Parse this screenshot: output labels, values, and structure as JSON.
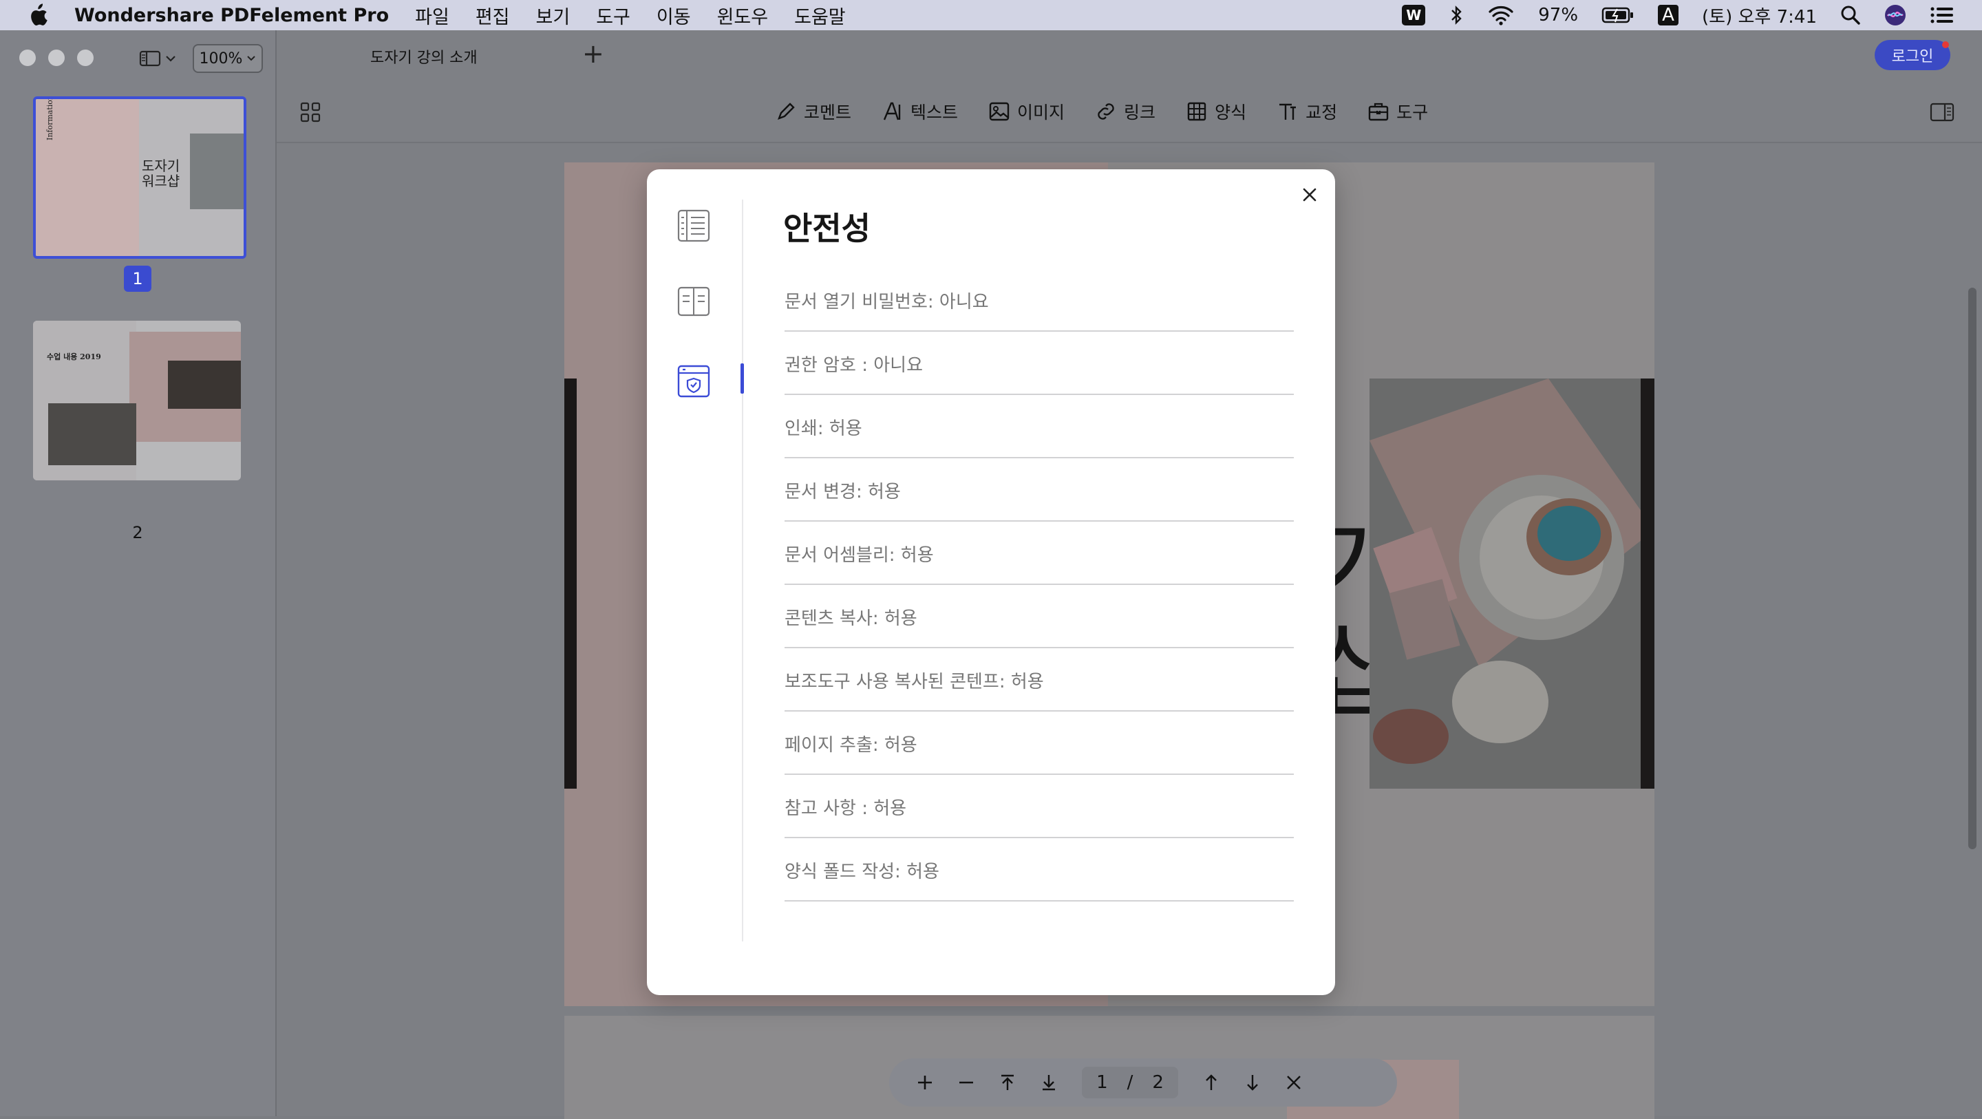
{
  "menubar": {
    "app_name": "Wondershare PDFelement Pro",
    "menus": [
      "파일",
      "편집",
      "보기",
      "도구",
      "이동",
      "윈도우",
      "도움말"
    ],
    "battery": "97%",
    "input_source": "A",
    "clock": "(토) 오후 7:41"
  },
  "sidebar": {
    "zoom": "100%",
    "pages": [
      "1",
      "2"
    ]
  },
  "tabbar": {
    "tab_title": "도자기 강의 소개",
    "add_tab": "+",
    "login": "로그인"
  },
  "toolbar": {
    "tools": [
      {
        "label": "코멘트",
        "icon": "pen-icon"
      },
      {
        "label": "텍스트",
        "icon": "text-icon"
      },
      {
        "label": "이미지",
        "icon": "image-icon"
      },
      {
        "label": "링크",
        "icon": "link-icon"
      },
      {
        "label": "양식",
        "icon": "table-icon"
      },
      {
        "label": "교정",
        "icon": "redact-icon"
      },
      {
        "label": "도구",
        "icon": "toolbox-icon"
      }
    ]
  },
  "document": {
    "thumb1_title": "도자기\n워크샵",
    "thumb1_side": "Information",
    "thumb2_title": "수업 내용 2019"
  },
  "pager": {
    "current": "1",
    "separator": "/",
    "total": "2"
  },
  "modal": {
    "title": "안전성",
    "rows": [
      "문서 열기 비밀번호: 아니요",
      "권한 암호 : 아니요",
      "인쇄: 허용",
      "문서 변경: 허용",
      "문서 어셈블리: 허용",
      "콘텐츠 복사: 허용",
      "보조도구 사용 복사된 콘텐프: 허용",
      "페이지 추출: 허용",
      "참고 사항 : 허용",
      "양식 폴드 작성: 허용"
    ]
  }
}
